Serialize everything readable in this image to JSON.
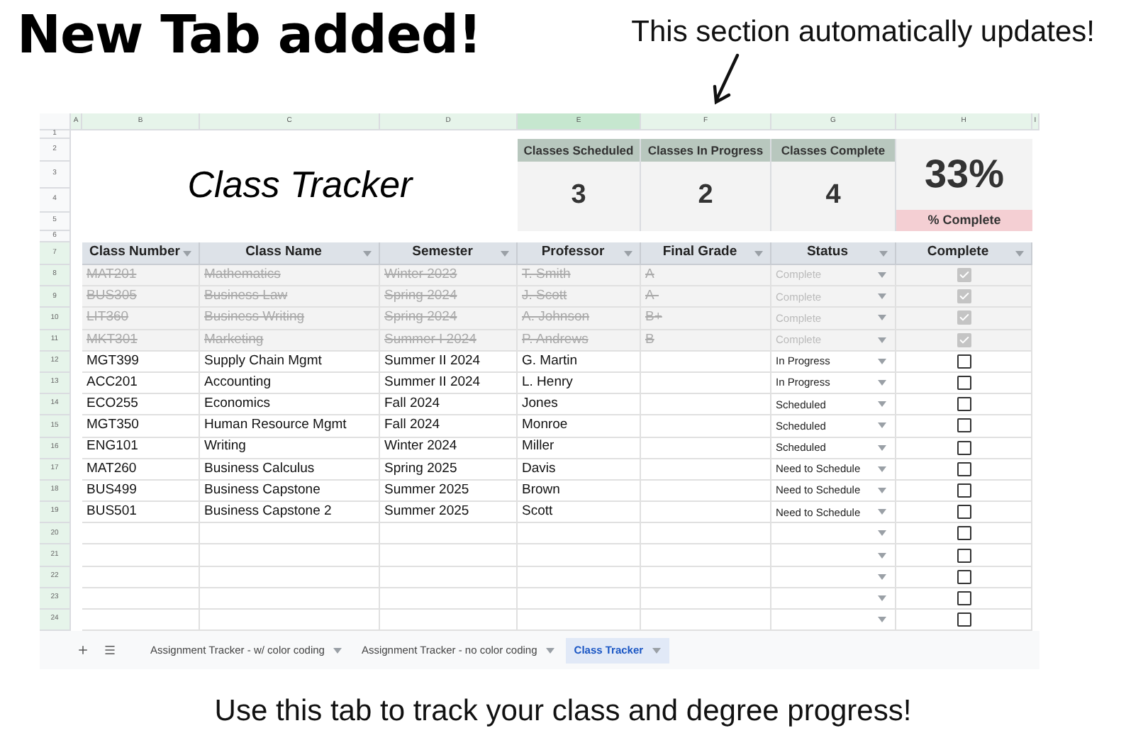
{
  "headline": "New Tab added!",
  "callout": "This section automatically updates!",
  "sheet": {
    "column_headers": [
      {
        "label": "A",
        "selected": false
      },
      {
        "label": "B",
        "selected": false
      },
      {
        "label": "C",
        "selected": false
      },
      {
        "label": "D",
        "selected": false
      },
      {
        "label": "E",
        "selected": true
      },
      {
        "label": "F",
        "selected": false
      },
      {
        "label": "G",
        "selected": false
      },
      {
        "label": "H",
        "selected": false
      },
      {
        "label": "I",
        "selected": false
      }
    ],
    "row_numbers": [
      {
        "label": "1",
        "selected": false
      },
      {
        "label": "2",
        "selected": false
      },
      {
        "label": "3",
        "selected": false
      },
      {
        "label": "4",
        "selected": false
      },
      {
        "label": "5",
        "selected": false
      },
      {
        "label": "6",
        "selected": false
      },
      {
        "label": "7",
        "selected": true
      },
      {
        "label": "8",
        "selected": true
      },
      {
        "label": "9",
        "selected": true
      },
      {
        "label": "10",
        "selected": true
      },
      {
        "label": "11",
        "selected": true
      },
      {
        "label": "12",
        "selected": true
      },
      {
        "label": "13",
        "selected": true
      },
      {
        "label": "14",
        "selected": true
      },
      {
        "label": "15",
        "selected": true
      },
      {
        "label": "16",
        "selected": true
      },
      {
        "label": "17",
        "selected": true
      },
      {
        "label": "18",
        "selected": true
      },
      {
        "label": "19",
        "selected": true
      },
      {
        "label": "20",
        "selected": true
      },
      {
        "label": "21",
        "selected": true
      },
      {
        "label": "22",
        "selected": true
      },
      {
        "label": "23",
        "selected": true
      },
      {
        "label": "24",
        "selected": true
      }
    ],
    "title": "Class Tracker",
    "stats": [
      {
        "label": "Classes Scheduled",
        "value": "3"
      },
      {
        "label": "Classes In Progress",
        "value": "2"
      },
      {
        "label": "Classes Complete",
        "value": "4"
      }
    ],
    "percent": {
      "value": "33%",
      "label": "% Complete"
    },
    "table": {
      "columns": [
        "Class Number",
        "Class Name",
        "Semester",
        "Professor",
        "Final Grade",
        "Status",
        "Complete"
      ],
      "rows": [
        {
          "cells": [
            "MAT201",
            "Mathematics",
            "Winter 2023",
            "T. Smith",
            "A"
          ],
          "status": "Complete",
          "complete": true
        },
        {
          "cells": [
            "BUS305",
            "Business Law",
            "Spring 2024",
            "J. Scott",
            "A-"
          ],
          "status": "Complete",
          "complete": true
        },
        {
          "cells": [
            "LIT360",
            "Business Writing",
            "Spring 2024",
            "A. Johnson",
            "B+"
          ],
          "status": "Complete",
          "complete": true
        },
        {
          "cells": [
            "MKT301",
            "Marketing",
            "Summer I 2024",
            "P. Andrews",
            "B"
          ],
          "status": "Complete",
          "complete": true
        },
        {
          "cells": [
            "MGT399",
            "Supply Chain Mgmt",
            "Summer II 2024",
            "G. Martin"
          ],
          "status": "In Progress",
          "complete": false
        },
        {
          "cells": [
            "ACC201",
            "Accounting",
            "Summer II 2024",
            "L. Henry"
          ],
          "status": "In Progress",
          "complete": false
        },
        {
          "cells": [
            "ECO255",
            "Economics",
            "Fall 2024",
            "Jones"
          ],
          "status": "Scheduled",
          "complete": false
        },
        {
          "cells": [
            "MGT350",
            "Human Resource Mgmt",
            "Fall 2024",
            "Monroe"
          ],
          "status": "Scheduled",
          "complete": false
        },
        {
          "cells": [
            "ENG101",
            "Writing",
            "Winter 2024",
            "Miller"
          ],
          "status": "Scheduled",
          "complete": false
        },
        {
          "cells": [
            "MAT260",
            "Business Calculus",
            "Spring 2025",
            "Davis"
          ],
          "status": "Need to Schedule",
          "complete": false
        },
        {
          "cells": [
            "BUS499",
            "Business Capstone",
            "Summer 2025",
            "Brown"
          ],
          "status": "Need to Schedule",
          "complete": false
        },
        {
          "cells": [
            "BUS501",
            "Business Capstone 2",
            "Summer 2025",
            "Scott"
          ],
          "status": "Need to Schedule",
          "complete": false
        },
        {
          "complete": false
        },
        {
          "complete": false
        },
        {
          "complete": false
        },
        {
          "complete": false
        },
        {
          "complete": false
        }
      ]
    },
    "sheet_tabs": [
      {
        "label": "Assignment Tracker - w/ color coding",
        "selected": false
      },
      {
        "label": "Assignment Tracker - no color coding",
        "selected": false
      },
      {
        "label": "Class Tracker",
        "selected": true
      }
    ]
  },
  "footer": "Use this tab to track your class and degree progress!"
}
